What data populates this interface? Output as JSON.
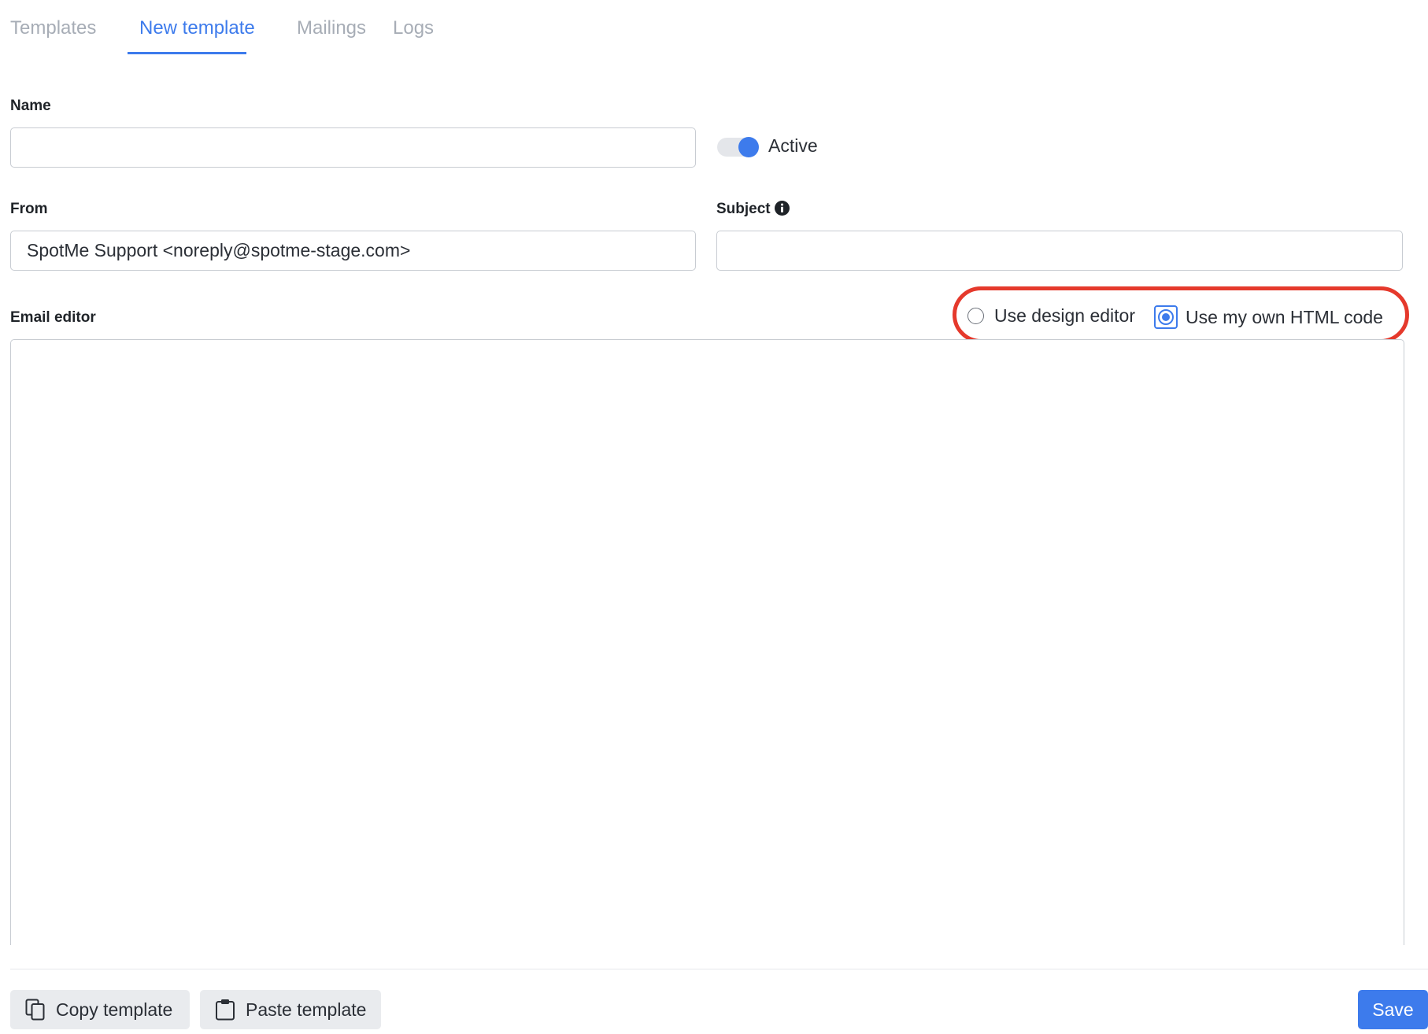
{
  "tabs": [
    {
      "label": "Templates",
      "active": false
    },
    {
      "label": "New template",
      "active": true
    },
    {
      "label": "Mailings",
      "active": false
    },
    {
      "label": "Logs",
      "active": false
    }
  ],
  "form": {
    "name": {
      "label": "Name",
      "value": ""
    },
    "active_toggle": {
      "label": "Active",
      "on": true
    },
    "from": {
      "label": "From",
      "value": "SpotMe Support <noreply@spotme-stage.com>"
    },
    "subject": {
      "label": "Subject",
      "value": "",
      "info_icon": "info-icon"
    },
    "email_editor": {
      "label": "Email editor",
      "options": [
        {
          "label": "Use design editor",
          "selected": false
        },
        {
          "label": "Use my own HTML code",
          "selected": true
        }
      ],
      "content": ""
    }
  },
  "footer": {
    "copy_label": "Copy template",
    "copy_icon": "copy-icon",
    "paste_label": "Paste template",
    "paste_icon": "clipboard-icon",
    "save_label": "Save"
  },
  "colors": {
    "accent": "#3d7bec",
    "inactive_tab": "#a7adb6",
    "highlight_annotation": "#e5392c"
  }
}
